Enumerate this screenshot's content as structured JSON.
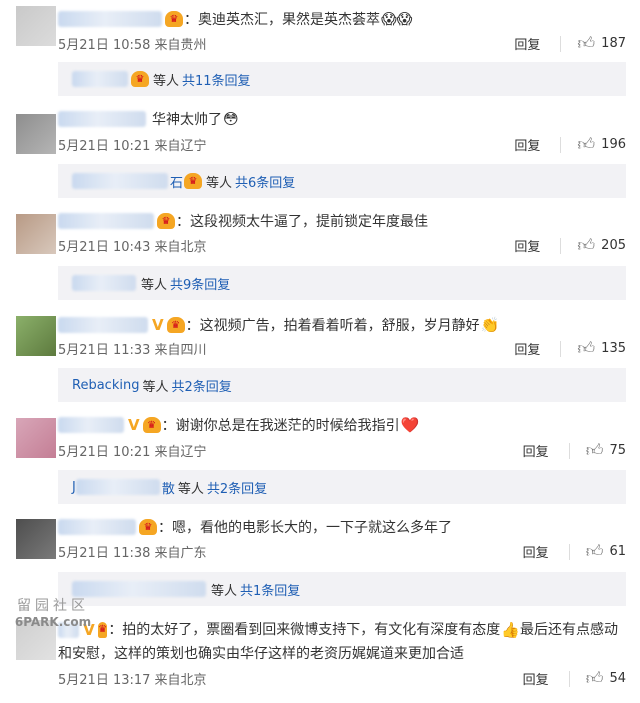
{
  "comments": [
    {
      "text": "：奥迪英杰汇，果然是英杰荟萃",
      "emoji": "😱😱",
      "time": "5月21日 10:58 来自贵州",
      "reply": "回复",
      "likes": "187",
      "sub": {
        "suffix": "等人",
        "count": "共11条回复"
      },
      "avatar_colors": [
        "#c9c9c9",
        "#dcdcdc"
      ]
    },
    {
      "text": "华神太帅了",
      "emoji": "😳",
      "time": "5月21日 10:21 来自辽宁",
      "reply": "回复",
      "likes": "196",
      "sub": {
        "name_tail": "石",
        "suffix": "等人",
        "count": "共6条回复"
      },
      "avatar_colors": [
        "#8e8e8e",
        "#b5b5b5"
      ]
    },
    {
      "text": "：这段视频太牛逼了，提前锁定年度最佳",
      "emoji": "",
      "time": "5月21日 10:43 来自北京",
      "reply": "回复",
      "likes": "205",
      "sub": {
        "suffix": "等人",
        "count": "共9条回复"
      },
      "avatar_colors": [
        "#b89a85",
        "#d8c8bc"
      ]
    },
    {
      "text": "：这视频广告，拍着看着听着，舒服，岁月静好",
      "emoji": "👏",
      "time": "5月21日 11:33 来自四川",
      "reply": "回复",
      "likes": "135",
      "sub": {
        "name": "Rebacking",
        "suffix": "等人",
        "count": "共2条回复"
      },
      "avatar_colors": [
        "#8bb06a",
        "#5d7a3e"
      ]
    },
    {
      "text": "：谢谢你总是在我迷茫的时候给我指引",
      "emoji": "❤️",
      "time": "5月21日 10:21 来自辽宁",
      "reply": "回复",
      "likes": "75",
      "sub": {
        "name_head": "J",
        "name_tail": "散",
        "suffix": "等人",
        "count": "共2条回复"
      },
      "avatar_colors": [
        "#d8a6b8",
        "#c47e95"
      ]
    },
    {
      "text": "：嗯，看他的电影长大的，一下子就这么多年了",
      "emoji": "",
      "time": "5月21日 11:38 来自广东",
      "reply": "回复",
      "likes": "61",
      "sub": {
        "suffix": "等人",
        "count": "共1条回复"
      },
      "avatar_colors": [
        "#4e4e4e",
        "#7a7a7a"
      ]
    },
    {
      "text_line1": "：拍的太好了，票圈看到回来微博支持下，有文化有深度有态度",
      "emoji": "👍",
      "text_line1b": "最后还有点感动",
      "text_line2": "和安慰，这样的策划也确实由华仔这样的老资历娓娓道来更加合适",
      "time": "5月21日 13:17 来自北京",
      "reply": "回复",
      "likes": "54",
      "avatar_colors": [
        "#cfcfcf",
        "#e2e2e2"
      ]
    }
  ],
  "watermark": {
    "line1": "留园社区",
    "line2": "6PARK.com"
  },
  "icons": {
    "like": "thumbs-up-icon",
    "vip": "vip-crown-icon",
    "verified": "verified-v-icon"
  },
  "colors": {
    "link": "#1f5fb4",
    "meta": "#666666",
    "sub_bg": "#f2f2f5",
    "badge": "#f5a623"
  }
}
